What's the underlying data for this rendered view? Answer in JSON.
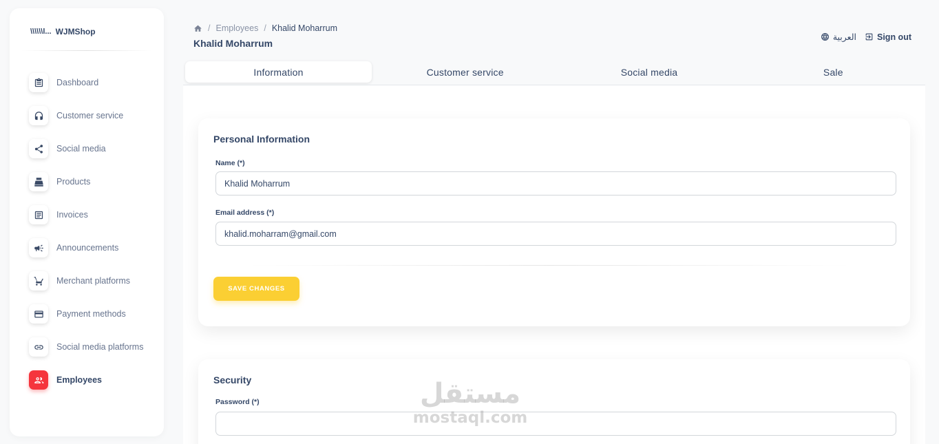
{
  "brand": {
    "logo_mark": "\\\\\\\\\\\\l...",
    "name": "WJMShop"
  },
  "sidebar": {
    "items": [
      {
        "label": "Dashboard",
        "icon": "clipboard-icon",
        "active": false
      },
      {
        "label": "Customer service",
        "icon": "headset-icon",
        "active": false
      },
      {
        "label": "Social media",
        "icon": "share-icon",
        "active": false
      },
      {
        "label": "Products",
        "icon": "cash-register-icon",
        "active": false
      },
      {
        "label": "Invoices",
        "icon": "invoice-icon",
        "active": false
      },
      {
        "label": "Announcements",
        "icon": "megaphone-icon",
        "active": false
      },
      {
        "label": "Merchant platforms",
        "icon": "cart-icon",
        "active": false
      },
      {
        "label": "Payment methods",
        "icon": "credit-card-icon",
        "active": false
      },
      {
        "label": "Social media platforms",
        "icon": "link-icon",
        "active": false
      },
      {
        "label": "Employees",
        "icon": "people-icon",
        "active": true
      }
    ]
  },
  "header": {
    "breadcrumb": {
      "section": "Employees",
      "current": "Khalid Moharrum"
    },
    "title": "Khalid Moharrum",
    "language_label": "العربية",
    "signout_label": "Sign out"
  },
  "tabs": [
    {
      "label": "Information",
      "active": true
    },
    {
      "label": "Customer service",
      "active": false
    },
    {
      "label": "Social media",
      "active": false
    },
    {
      "label": "Sale",
      "active": false
    }
  ],
  "personal": {
    "title": "Personal Information",
    "name_label": "Name (*)",
    "name_value": "Khalid Moharrum",
    "email_label": "Email address (*)",
    "email_value": "khalid.moharram@gmail.com",
    "save_label": "SAVE CHANGES"
  },
  "security": {
    "title": "Security",
    "password_label": "Password (*)",
    "password_value": ""
  },
  "watermark": {
    "arabic": "مستقل",
    "latin": "mostaql.com"
  },
  "colors": {
    "accent_yellow": "#fbcf33",
    "active_red": "#f5353d",
    "text_dark": "#344767"
  }
}
